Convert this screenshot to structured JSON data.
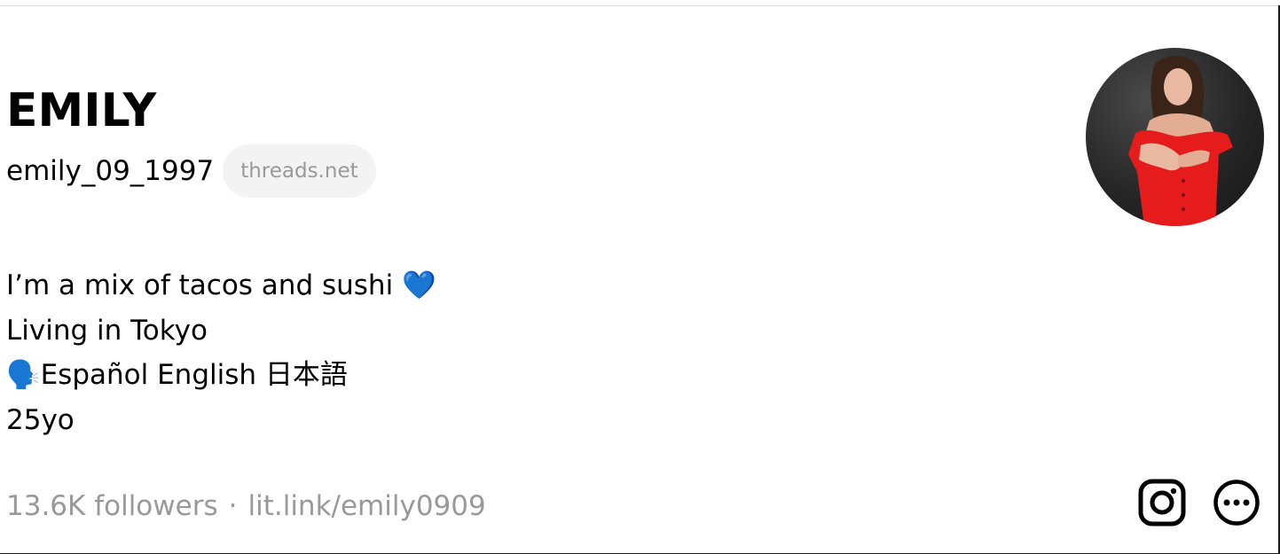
{
  "profile": {
    "display_name": "EMILY",
    "username": "emily_09_1997",
    "domain_badge": "threads.net",
    "avatar_icon": "avatar-photo"
  },
  "bio": {
    "lines": [
      "I’m a mix of tacos and sushi 💙",
      "Living in Tokyo",
      "🗣️Español English 日本語",
      "25yo"
    ]
  },
  "footer": {
    "followers": "13.6K followers",
    "separator": "·",
    "link": "lit.link/emily0909"
  },
  "actions": {
    "instagram_icon": "instagram-icon",
    "more_icon": "more-options-icon"
  },
  "colors": {
    "muted_text": "#999999",
    "pill_background": "#f3f3f3",
    "text": "#000000"
  }
}
